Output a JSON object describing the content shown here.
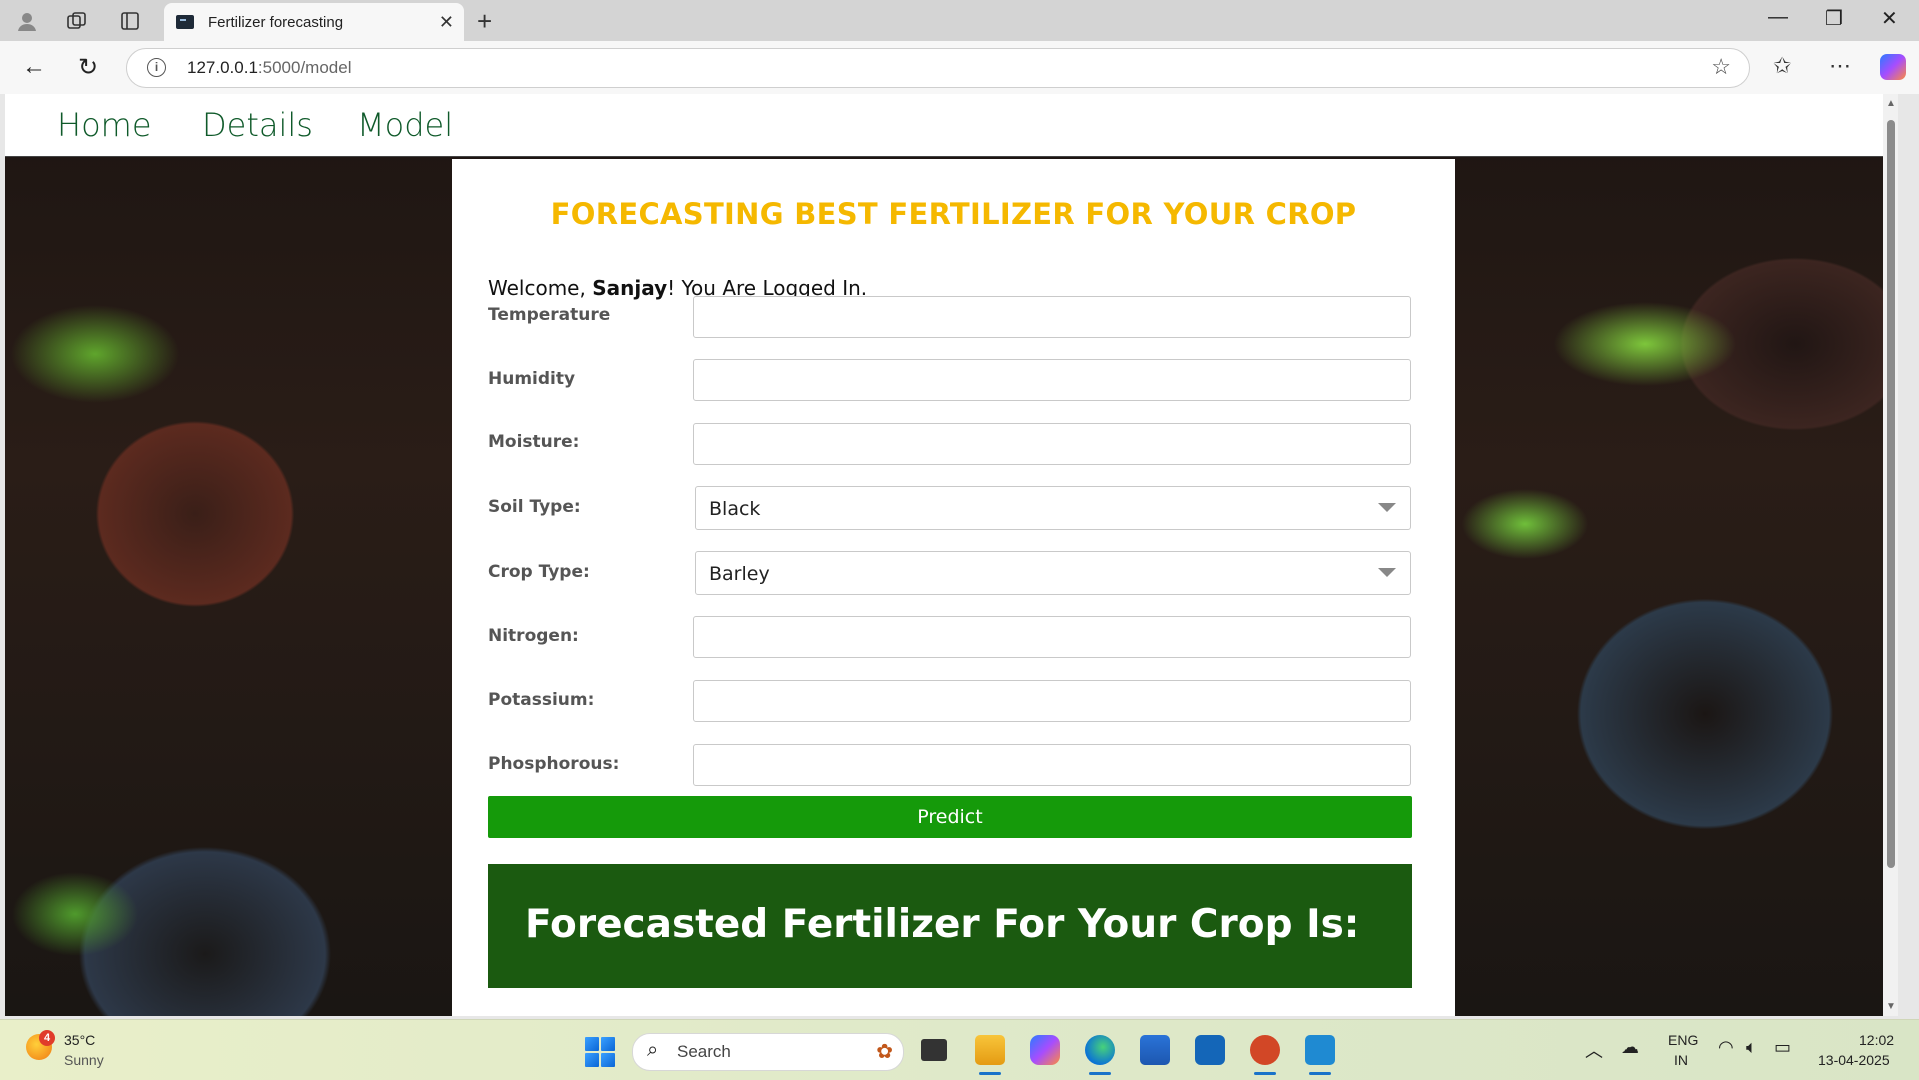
{
  "browser": {
    "tab_title": "Fertilizer forecasting",
    "url_host": "127.0.0.1",
    "url_path": ":5000/model",
    "window_controls": [
      "minimize",
      "restore",
      "close"
    ]
  },
  "nav": {
    "items": [
      "Home",
      "Details",
      "Model"
    ]
  },
  "card": {
    "title": "FORECASTING BEST FERTILIZER FOR YOUR CROP",
    "welcome_prefix": "Welcome, ",
    "username": "Sanjay",
    "welcome_suffix": "! You Are Logged In."
  },
  "form": {
    "temperature_label": "Temperature",
    "temperature_value": "",
    "humidity_label": "Humidity",
    "humidity_value": "",
    "moisture_label": "Moisture:",
    "moisture_value": "",
    "soil_type_label": "Soil Type:",
    "soil_type_value": "Black",
    "crop_type_label": "Crop Type:",
    "crop_type_value": "Barley",
    "nitrogen_label": "Nitrogen:",
    "nitrogen_value": "",
    "potassium_label": "Potassium:",
    "potassium_value": "",
    "phosphorous_label": "Phosphorous:",
    "phosphorous_value": "",
    "predict_label": "Predict"
  },
  "result": {
    "heading": "Forecasted Fertilizer For Your Crop Is:"
  },
  "taskbar": {
    "weather_badge": "4",
    "temperature": "35°C",
    "condition": "Sunny",
    "search_label": "Search",
    "lang_line1": "ENG",
    "lang_line2": "IN",
    "time": "12:02",
    "date": "13-04-2025"
  },
  "colors": {
    "accent_title": "#f5b800",
    "predict_button": "#159a0a",
    "result_box": "#1b5a10",
    "nav_link": "#0f5a2a"
  }
}
